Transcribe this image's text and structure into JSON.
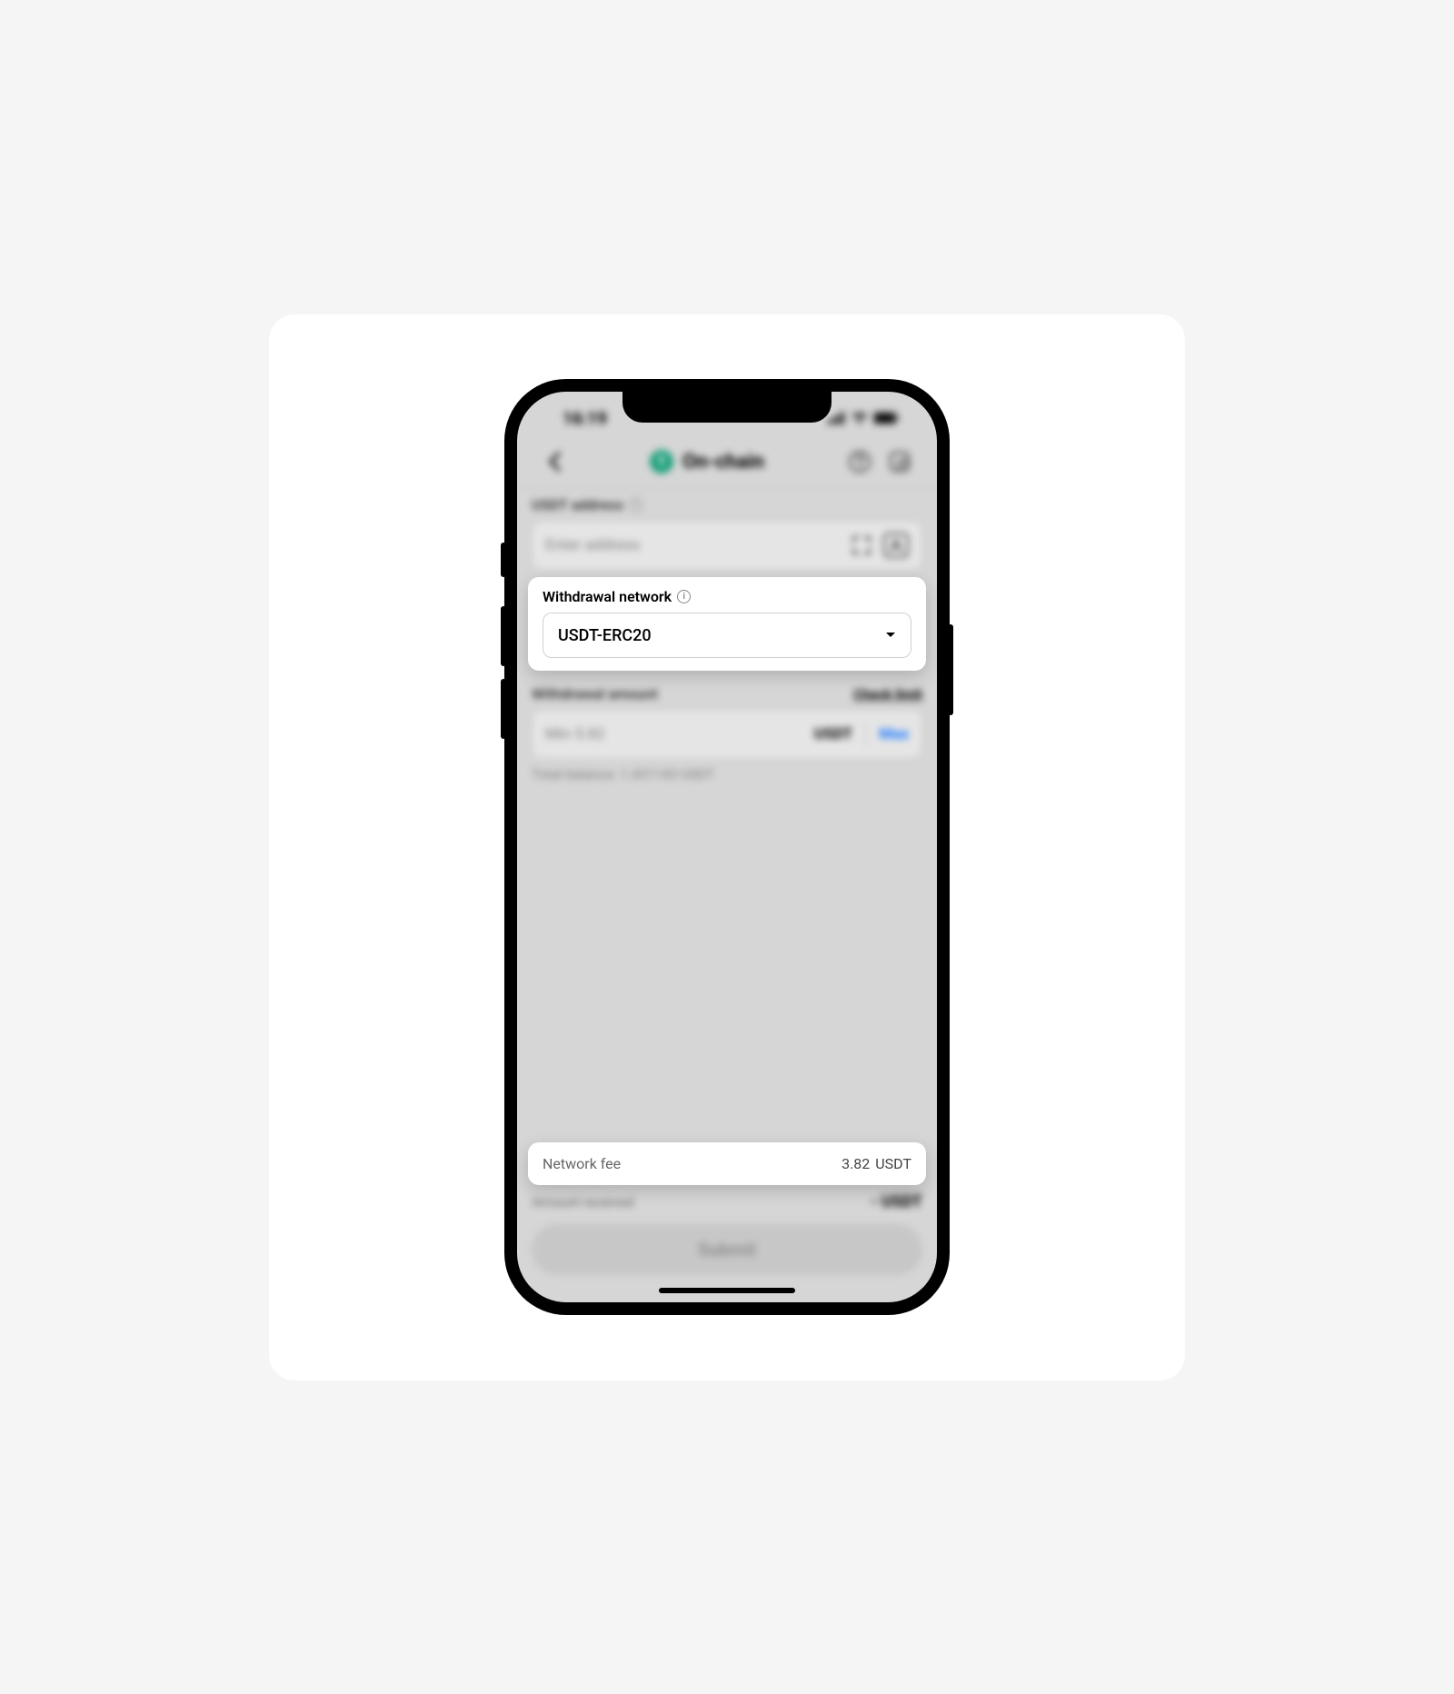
{
  "status": {
    "time": "16:19"
  },
  "header": {
    "title": "On-chain",
    "token_initial": "T"
  },
  "address": {
    "label": "USDT address",
    "placeholder": "Enter address"
  },
  "network": {
    "label": "Withdrawal network",
    "selected": "USDT-ERC20"
  },
  "amount": {
    "label": "Withdrawal amount",
    "check_limit": "Check limit",
    "placeholder": "Min 5.82",
    "unit": "USDT",
    "max": "Max",
    "balance_text": "Total balance: 1.431143 USDT"
  },
  "fee": {
    "label": "Network fee",
    "value": "3.82",
    "unit": "USDT"
  },
  "received": {
    "label": "Amount received",
    "value": "- USDT"
  },
  "submit": {
    "label": "Submit"
  }
}
